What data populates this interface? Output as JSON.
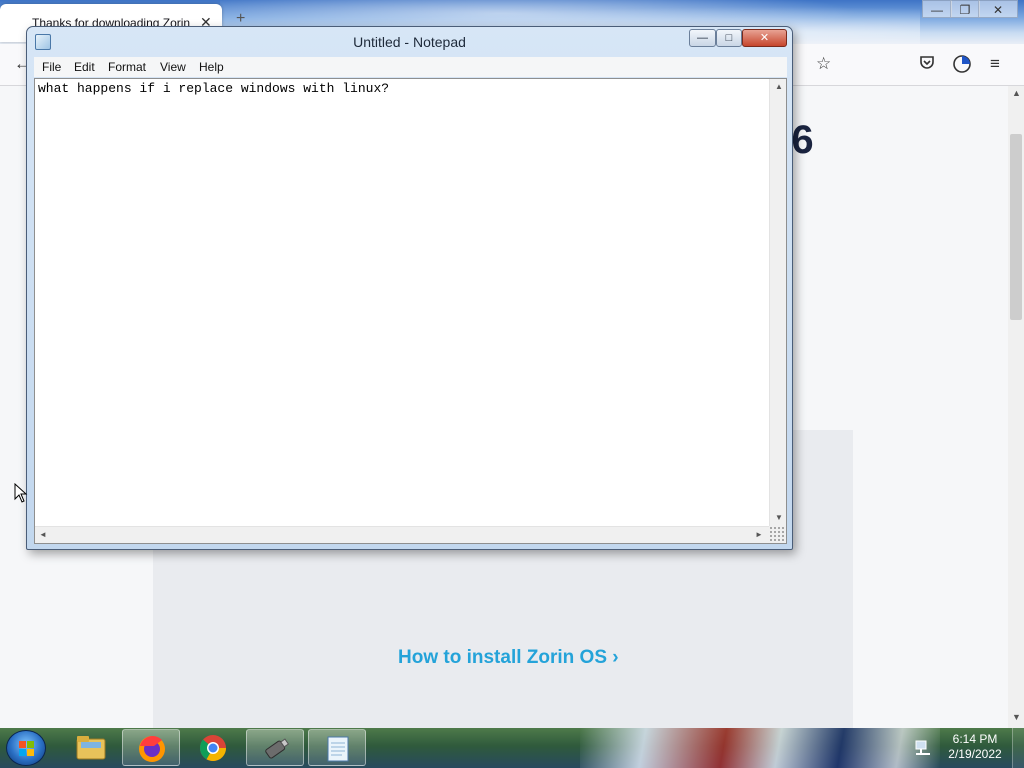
{
  "browser": {
    "tab_title": "Thanks for downloading Zorin",
    "tab_close": "✕",
    "new_tab": "+",
    "window_controls": {
      "minimize": "—",
      "restore": "❐",
      "close": "✕"
    },
    "nav": {
      "back": "←",
      "bookmark": "☆",
      "menu": "≡"
    },
    "page": {
      "heading_fragment": "M6",
      "install_link": "How to install Zorin OS ›"
    }
  },
  "notepad": {
    "title": "Untitled - Notepad",
    "window_controls": {
      "minimize": "—",
      "maximize": "□",
      "close": "✕"
    },
    "menu": [
      "File",
      "Edit",
      "Format",
      "View",
      "Help"
    ],
    "content": "what happens if i replace windows with linux?",
    "scroll_arrows": {
      "up": "▲",
      "down": "▼",
      "left": "◄",
      "right": "►"
    }
  },
  "taskbar": {
    "apps": [
      "windows-explorer",
      "firefox",
      "chrome",
      "usb-tool",
      "notepad"
    ],
    "active_app": "notepad",
    "clock_time": "6:14 PM",
    "clock_date": "2/19/2022"
  },
  "colors": {
    "link": "#24a3d9",
    "heading": "#1a2440",
    "taskbar": "#2f5a3c"
  }
}
